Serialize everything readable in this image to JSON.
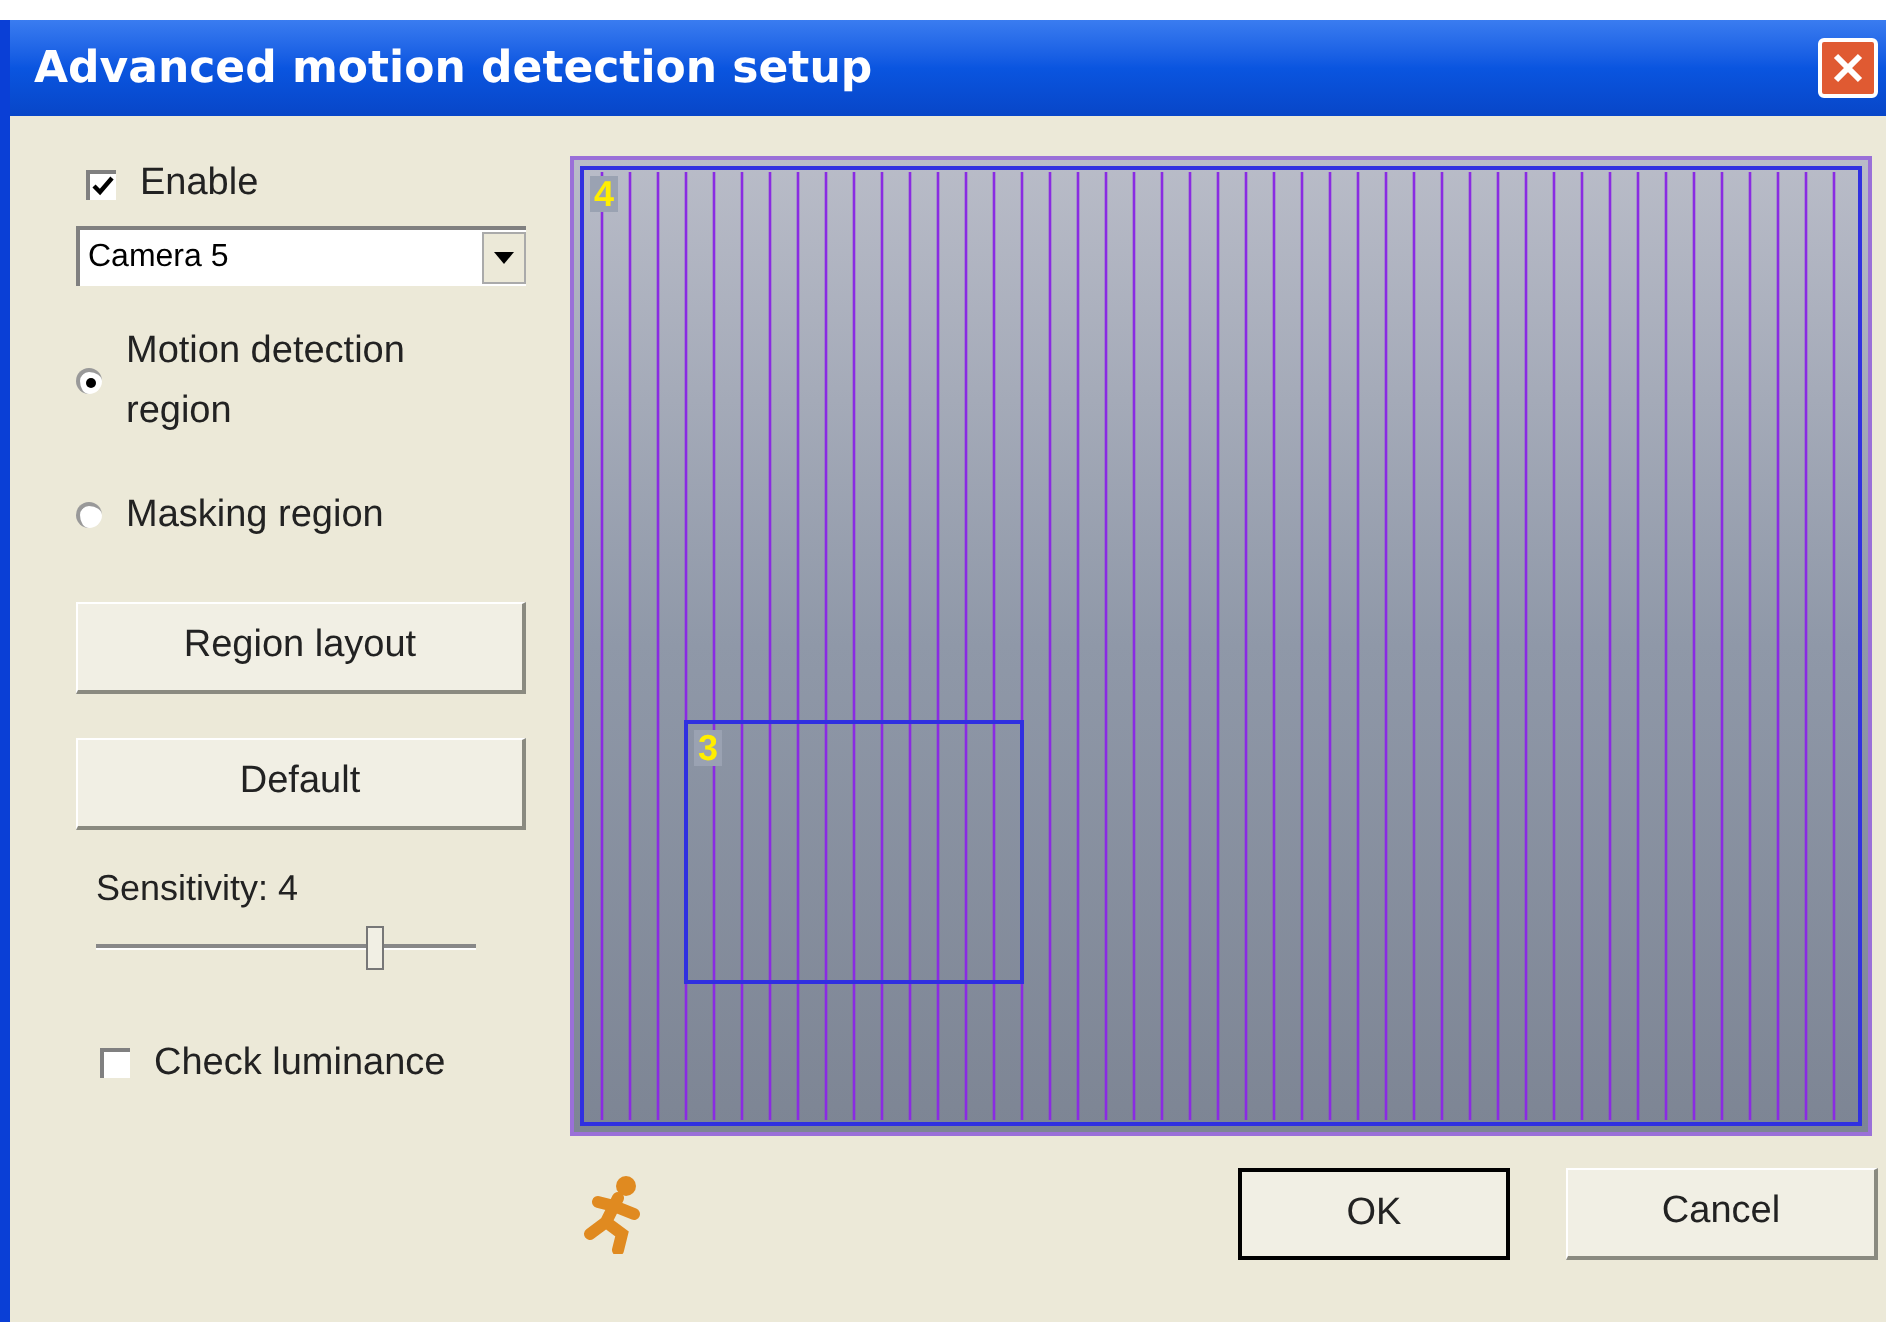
{
  "window": {
    "title": "Advanced motion detection setup"
  },
  "enable": {
    "label": "Enable",
    "checked": true
  },
  "camera_select": {
    "value": "Camera 5"
  },
  "region_mode": [
    {
      "label": "Motion detection region",
      "selected": true
    },
    {
      "label": "Masking region",
      "selected": false
    }
  ],
  "buttons": [
    "Region layout",
    "Default"
  ],
  "sensitivity": {
    "label": "Sensitivity: 4",
    "level": 0.73
  },
  "check_luminance": {
    "label": "Check luminance",
    "checked": false
  },
  "video": {
    "regions": [
      {
        "label": "4"
      },
      {
        "label": "3"
      }
    ]
  },
  "dialog_buttons": [
    {
      "label": "OK",
      "default": true
    },
    {
      "label": "Cancel",
      "default": false
    }
  ]
}
